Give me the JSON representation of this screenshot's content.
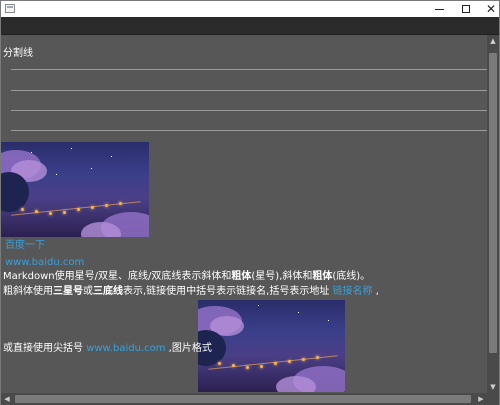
{
  "section": {
    "title": "分割线"
  },
  "links": {
    "baidu_text": "百度一下",
    "baidu_url_text": "www.baidu.com",
    "link_name": "链接名称",
    "angle_url": "www.baidu.com"
  },
  "paragraph1": {
    "p1": "Markdown使用星号/双星、底线/双底线表示斜体和",
    "b1": "粗体",
    "p2": "(星号),斜体和",
    "b2": "粗体",
    "p3": "(底线)。"
  },
  "paragraph2": {
    "p1": "粗斜体使用",
    "b1": "三星号",
    "p2": "或",
    "b2": "三底线",
    "p3": "表示,链接使用中括号表示链接名,括号表示地址 ",
    "p4": " ,"
  },
  "paragraph3": {
    "p1": "或直接使用尖括号 ",
    "p2": " ,图片格式"
  },
  "icons": {
    "app": "app-icon",
    "minimize": "minimize-icon",
    "maximize": "maximize-icon",
    "close": "close-icon"
  },
  "colors": {
    "content_bg": "#575757",
    "toolbar_bg": "#2b2b2b",
    "link": "#3aa0d8",
    "text": "#ffffff"
  }
}
